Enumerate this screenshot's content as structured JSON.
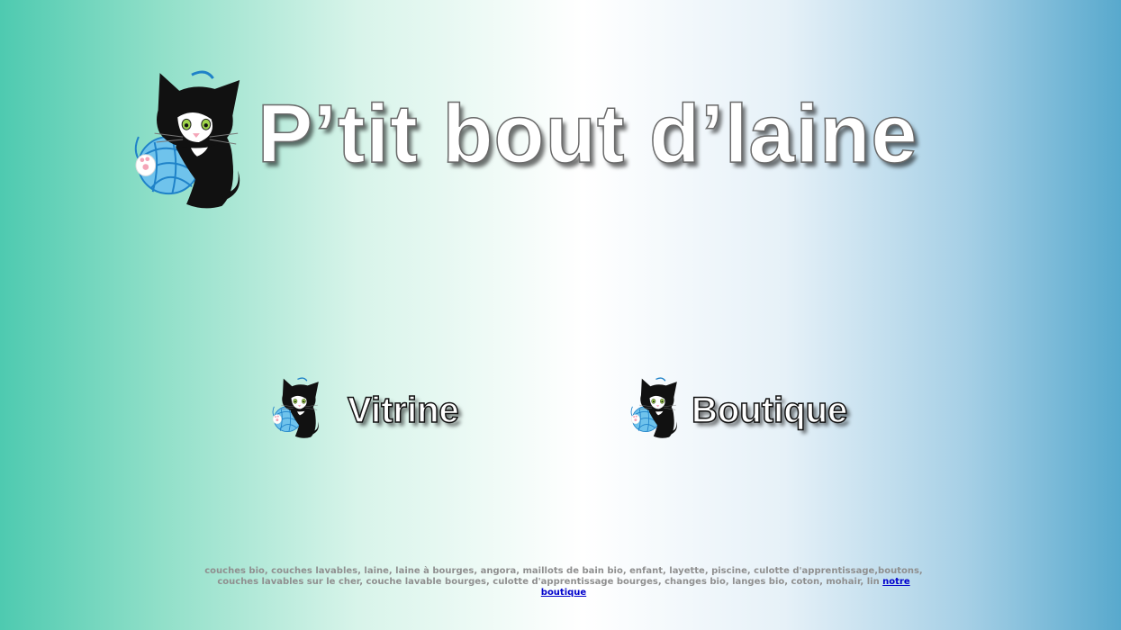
{
  "header": {
    "title": "P’tit bout d’laine",
    "logo_icon": "kitten-with-yarn-icon"
  },
  "nav": {
    "vitrine": {
      "label": "Vitrine",
      "icon": "kitten-with-yarn-icon"
    },
    "boutique": {
      "label": "Boutique",
      "icon": "kitten-with-yarn-icon"
    }
  },
  "footer": {
    "keywords": "couches bio, couches lavables, laine, laine à bourges, angora, maillots de bain bio, enfant, layette, piscine, culotte d'apprentissage,boutons, couches lavables sur le cher, couche lavable bourges, culotte d'apprentissage bourges, changes bio, langes bio, coton, mohair, lin",
    "link_label": "notre boutique"
  },
  "colors": {
    "bg_left": "#4ecab0",
    "bg_center": "#ffffff",
    "bg_right": "#58a9cd",
    "yarn_blue": "#3aa0dc",
    "cat_black": "#111111",
    "link_blue": "#0000cc",
    "footer_text": "#8f8f8f"
  }
}
